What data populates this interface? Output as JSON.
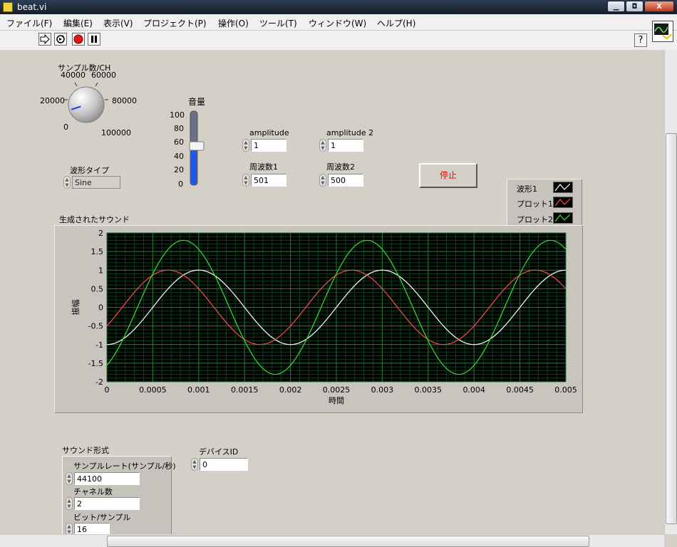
{
  "window": {
    "title": "beat.vi",
    "controls": {
      "minimize": "▁",
      "maximize": "◘",
      "close": "X"
    }
  },
  "menu": [
    "ファイル(F)",
    "編集(E)",
    "表示(V)",
    "プロジェクト(P)",
    "操作(O)",
    "ツール(T)",
    "ウィンドウ(W)",
    "ヘルプ(H)"
  ],
  "toolbar": {
    "help_label": "?"
  },
  "knob": {
    "label": "サンプル数/CH",
    "ticks": [
      "0",
      "20000",
      "40000",
      "60000",
      "80000",
      "100000"
    ],
    "value_fraction": 0.1
  },
  "volume": {
    "label": "音量",
    "ticks": [
      "100",
      "80",
      "60",
      "40",
      "20",
      "0"
    ],
    "value": 53
  },
  "amplitude1": {
    "label": "amplitude",
    "value": "1"
  },
  "amplitude2": {
    "label": "amplitude 2",
    "value": "1"
  },
  "freq1": {
    "label": "周波数1",
    "value": "501"
  },
  "freq2": {
    "label": "周波数2",
    "value": "500"
  },
  "waveform_type": {
    "label": "波形タイプ",
    "value": "Sine"
  },
  "stop_button": {
    "label": "停止"
  },
  "legend": [
    {
      "name": "波形1",
      "color": "#ffffff"
    },
    {
      "name": "プロット1",
      "color": "#ff4a4a"
    },
    {
      "name": "プロット2",
      "color": "#33e033"
    }
  ],
  "graph": {
    "title": "生成されたサウンド"
  },
  "chart_data": {
    "type": "line",
    "title": "生成されたサウンド",
    "xlabel": "時間",
    "ylabel": "振幅",
    "xlim": [
      0,
      0.005
    ],
    "ylim": [
      -2,
      2
    ],
    "xticks": [
      "0",
      "0.0005",
      "0.001",
      "0.0015",
      "0.002",
      "0.0025",
      "0.003",
      "0.0035",
      "0.004",
      "0.0045",
      "0.005"
    ],
    "yticks": [
      "2",
      "1.5",
      "1",
      "0.5",
      "0",
      "-0.5",
      "-1",
      "-1.5",
      "-2"
    ],
    "grid": true,
    "series": [
      {
        "name": "波形1",
        "color": "#ffffff",
        "amplitude": 1,
        "frequency": 500,
        "phase_deg": -90
      },
      {
        "name": "プロット1",
        "color": "#ff4a4a",
        "amplitude": 1,
        "frequency": 500,
        "phase_deg": -30
      },
      {
        "name": "プロット2",
        "color": "#33e033",
        "amplitude": 1.8,
        "frequency": 500,
        "phase_deg": -60
      }
    ]
  },
  "sound_format": {
    "label": "サウンド形式",
    "sample_rate_label": "サンプルレート(サンプル/秒)",
    "sample_rate": "44100",
    "channels_label": "チャネル数",
    "channels": "2",
    "bits_label": "ビット/サンプル",
    "bits": "16"
  },
  "device_id": {
    "label": "デバイスID",
    "value": "0"
  }
}
